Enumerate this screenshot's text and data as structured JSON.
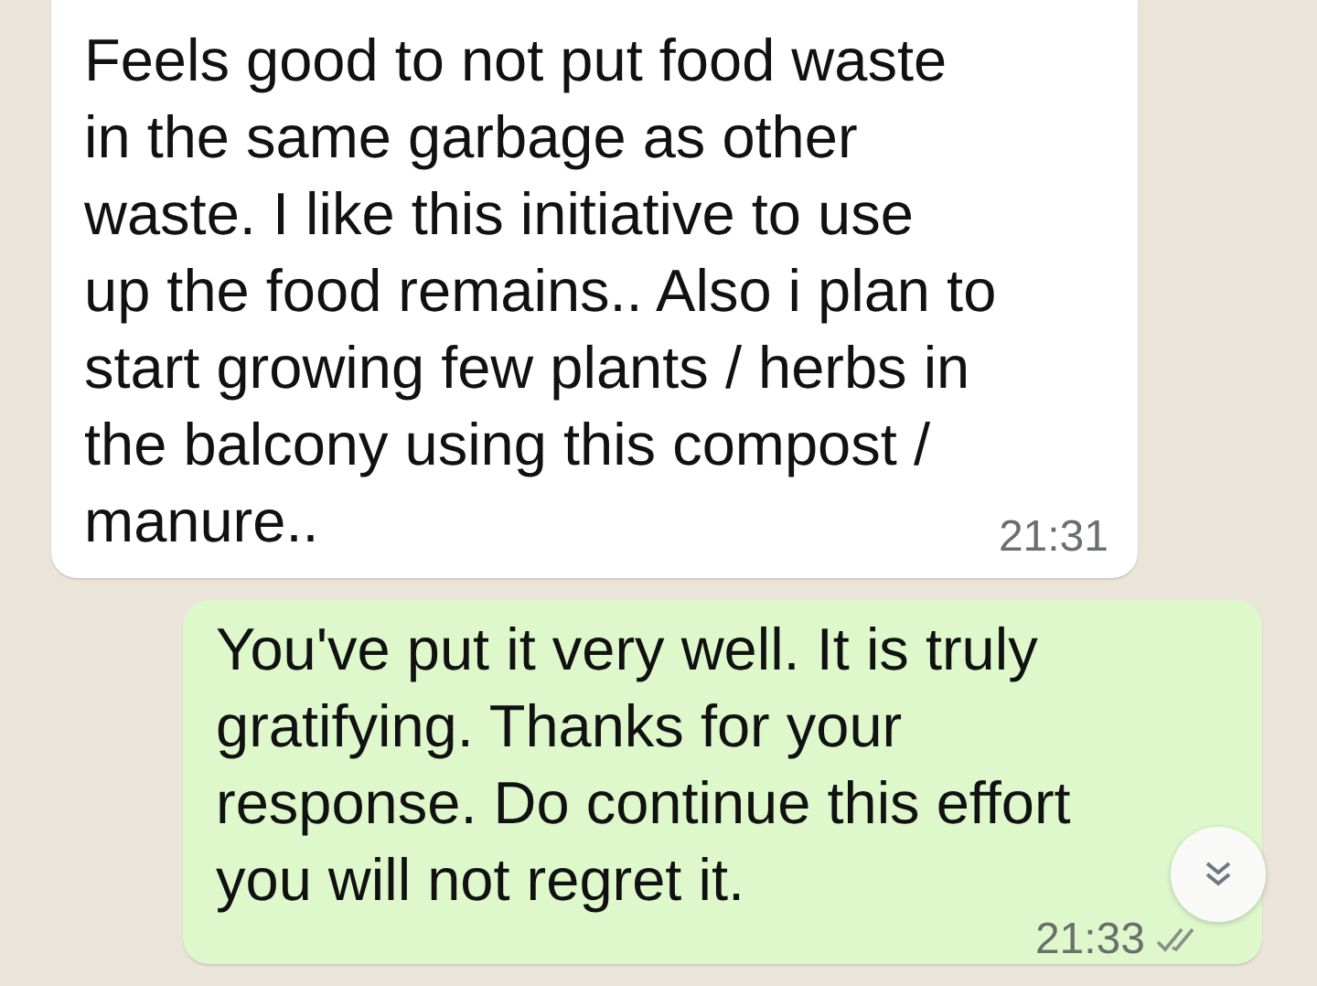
{
  "messages": [
    {
      "outgoing": false,
      "lines": [
        "Feels good to not put food waste",
        "in the same garbage as other",
        "waste. I like this initiative to use",
        "up the food remains.. Also i plan to",
        "start growing few plants / herbs in",
        "the balcony using this compost /",
        "manure.."
      ],
      "time": "21:31"
    },
    {
      "outgoing": true,
      "lines": [
        "You've put it very well. It is truly",
        "gratifying. Thanks for your",
        "response. Do continue this effort",
        "you will not regret it."
      ],
      "time": "21:33",
      "read": false
    }
  ]
}
